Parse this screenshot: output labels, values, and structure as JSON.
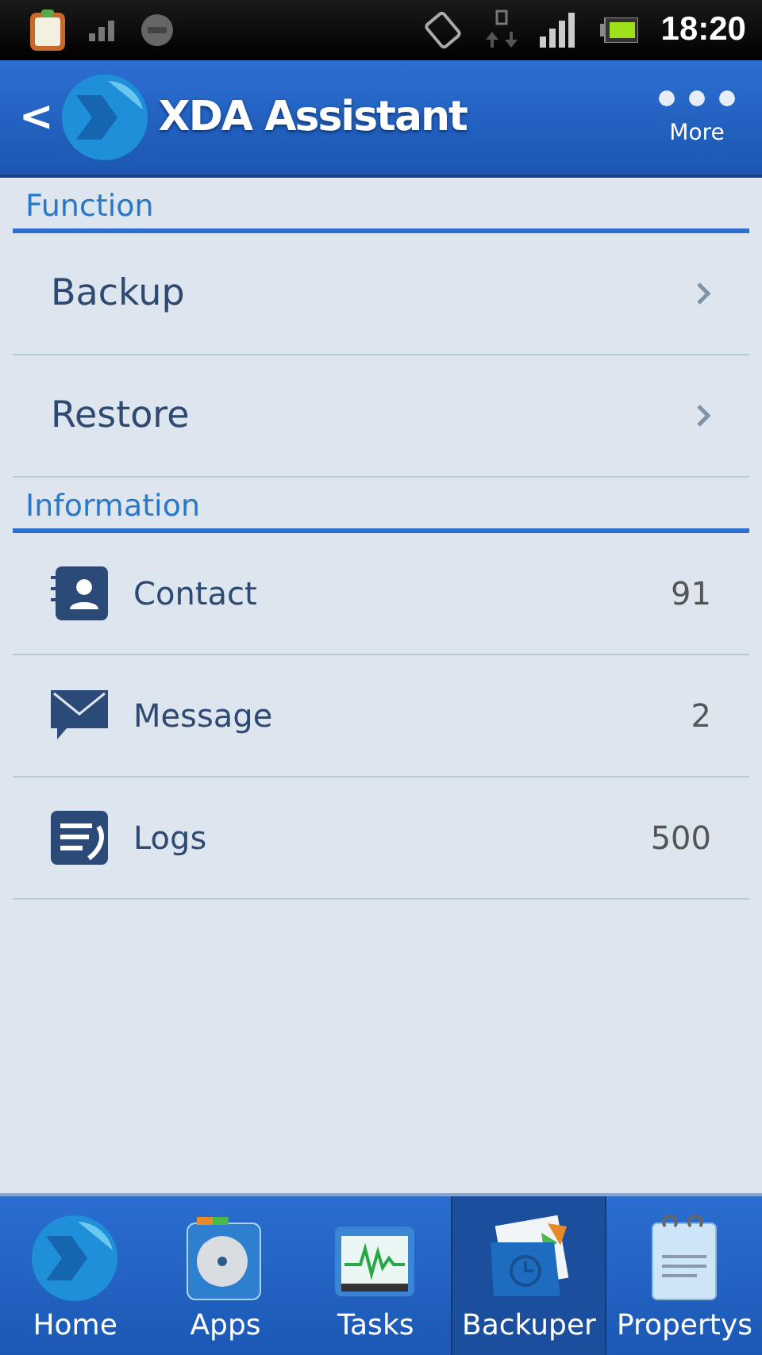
{
  "status_bar": {
    "time": "18:20"
  },
  "header": {
    "back": "<",
    "title": "XDA Assistant",
    "more": "More"
  },
  "sections": [
    {
      "title": "Function",
      "rows": [
        {
          "kind": "nav",
          "label": "Backup"
        },
        {
          "kind": "nav",
          "label": "Restore"
        }
      ]
    },
    {
      "title": "Information",
      "rows": [
        {
          "kind": "count",
          "label": "Contact",
          "value": "91"
        },
        {
          "kind": "count",
          "label": "Message",
          "value": "2"
        },
        {
          "kind": "count",
          "label": "Logs",
          "value": "500"
        }
      ]
    }
  ],
  "tabs": [
    {
      "kind": "home",
      "label": "Home",
      "selected": false
    },
    {
      "kind": "apps",
      "label": "Apps",
      "selected": false
    },
    {
      "kind": "tasks",
      "label": "Tasks",
      "selected": false
    },
    {
      "kind": "backuper",
      "label": "Backuper",
      "selected": true
    },
    {
      "kind": "propertys",
      "label": "Propertys",
      "selected": false
    }
  ]
}
